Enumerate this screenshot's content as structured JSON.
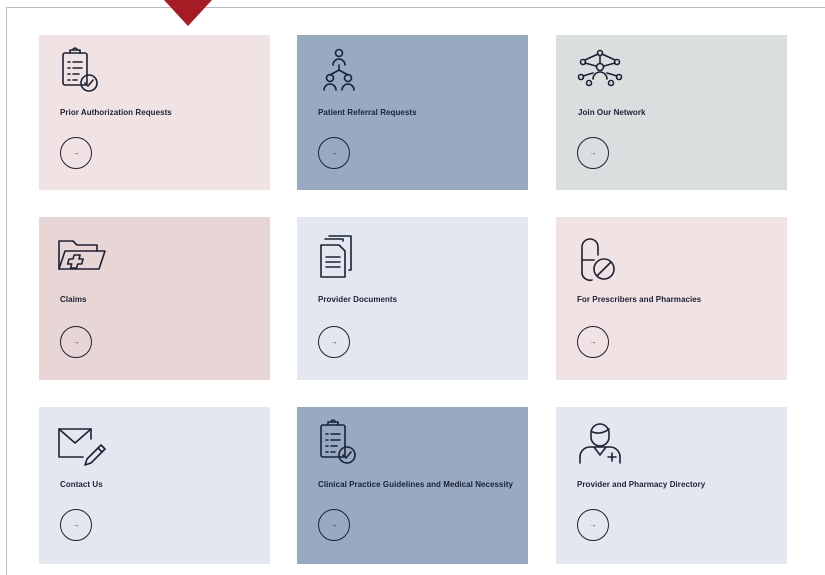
{
  "colors": {
    "pink": "#f1e3e4",
    "rose": "#e8d5d6",
    "slate": "#98a9c2",
    "gray": "#dadedf",
    "pale_blue": "#e3e7f0",
    "pointer": "#a51c24",
    "ink": "#1b2234"
  },
  "arrow_glyph": "→",
  "cards": [
    {
      "label": "Prior Authorization Requests",
      "icon": "clipboard-check-icon",
      "color": "pink"
    },
    {
      "label": "Patient Referral Requests",
      "icon": "people-network-icon",
      "color": "slate"
    },
    {
      "label": "Join Our Network",
      "icon": "network-nodes-icon",
      "color": "gray"
    },
    {
      "label": "Claims",
      "icon": "folder-medical-icon",
      "color": "rose"
    },
    {
      "label": "Provider Documents",
      "icon": "documents-icon",
      "color": "pale_blue"
    },
    {
      "label": "For Prescribers and Pharmacies",
      "icon": "pill-prohibited-icon",
      "color": "pink"
    },
    {
      "label": "Contact Us",
      "icon": "envelope-pencil-icon",
      "color": "pale_blue"
    },
    {
      "label": "Clinical Practice Guidelines and Medical Necessity",
      "icon": "clipboard-check-icon",
      "color": "slate"
    },
    {
      "label": "Provider and Pharmacy Directory",
      "icon": "doctor-icon",
      "color": "pale_blue"
    }
  ]
}
